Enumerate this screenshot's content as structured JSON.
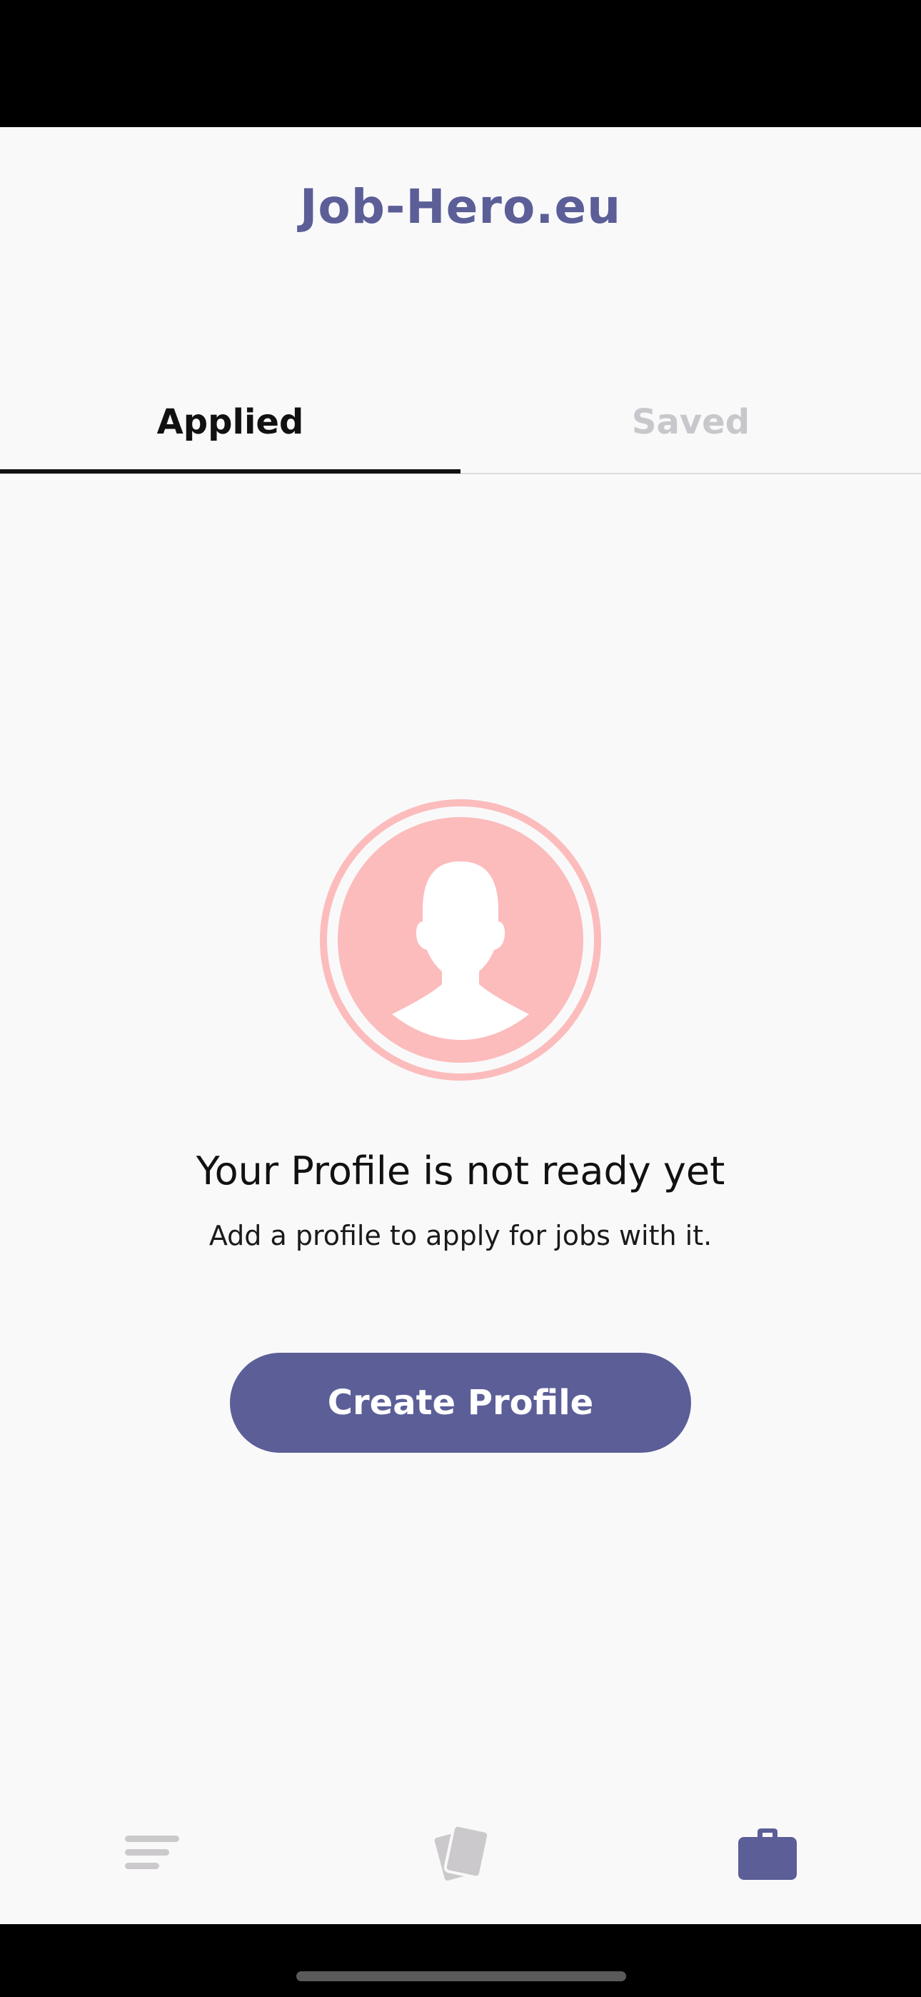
{
  "app": {
    "title": "Job-Hero.eu",
    "accent_color": "#5b5e97",
    "avatar_color": "#fcbcbc"
  },
  "tabs": [
    {
      "label": "Applied",
      "active": true
    },
    {
      "label": "Saved",
      "active": false
    }
  ],
  "empty_state": {
    "icon": "user-silhouette-icon",
    "title": "Your Profile is not ready yet",
    "subtitle": "Add a profile to apply for jobs with it.",
    "button_label": "Create Profile"
  },
  "bottom_nav": [
    {
      "icon": "filter-list-icon",
      "active": false
    },
    {
      "icon": "cards-stack-icon",
      "active": false
    },
    {
      "icon": "briefcase-icon",
      "active": true
    }
  ]
}
